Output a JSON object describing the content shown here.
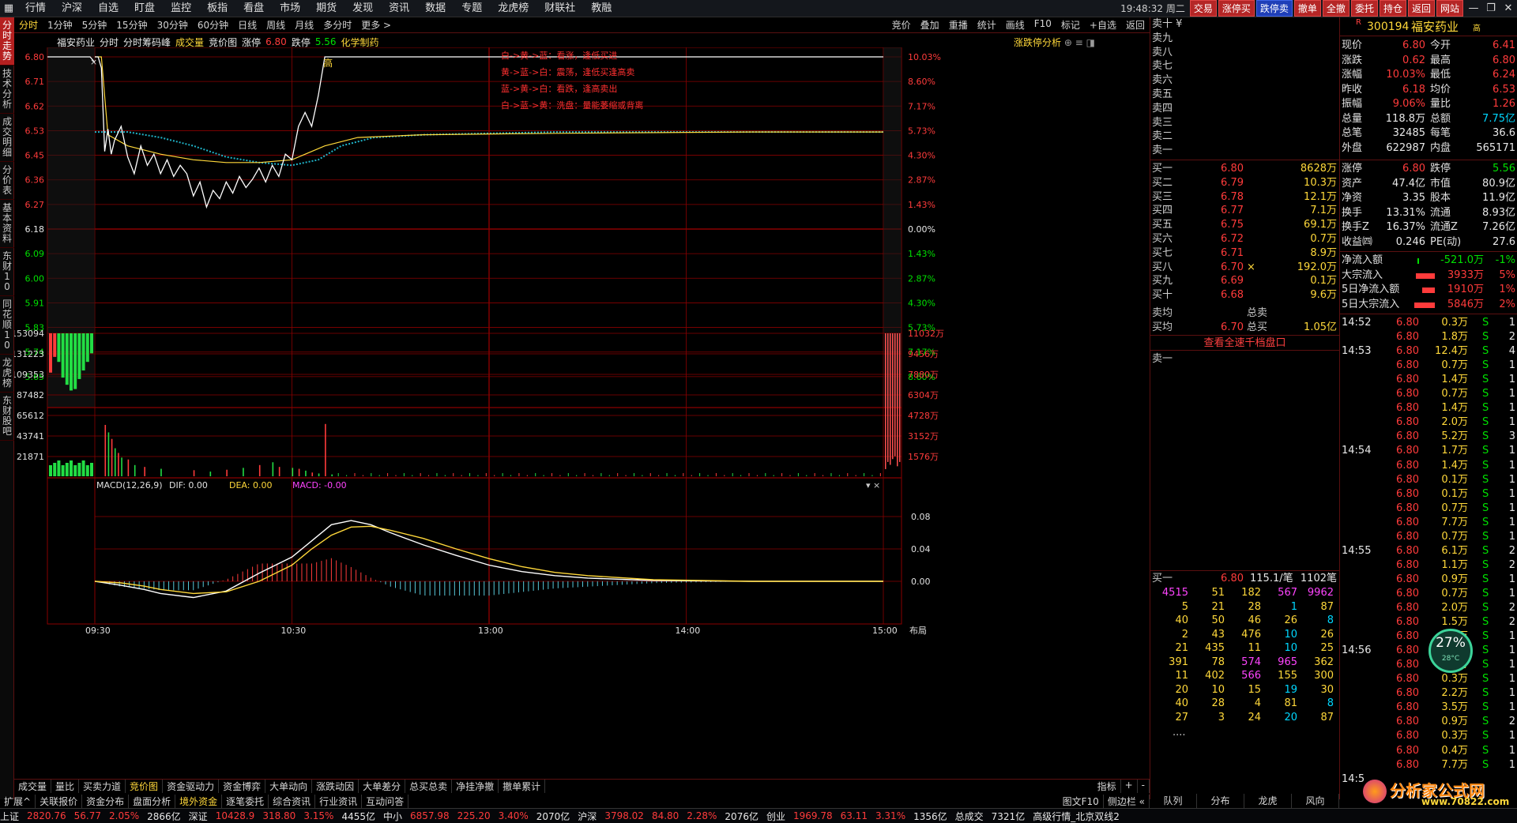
{
  "topbar": {
    "menu": [
      "行情",
      "沪深",
      "自选",
      "盯盘",
      "监控",
      "板指",
      "看盘",
      "市场",
      "期货",
      "发现",
      "资讯",
      "数据",
      "专题",
      "龙虎榜",
      "财联社",
      "教融"
    ],
    "clock": "19:48:32",
    "weekday": "周二",
    "buttons": [
      "交易",
      "涨停买",
      "跌停卖",
      "撤单",
      "全撤",
      "委托",
      "持仓",
      "返回",
      "网站"
    ]
  },
  "left_tabs": [
    "分时走势",
    "技术分析",
    "成交明细",
    "分价表",
    "基本资料",
    "东财10",
    "同花顺10",
    "龙虎榜",
    "东财股吧"
  ],
  "chart_toolbar": {
    "periods": [
      "分时",
      "1分钟",
      "5分钟",
      "15分钟",
      "30分钟",
      "60分钟",
      "日线",
      "周线",
      "月线",
      "多分时",
      "更多 >"
    ],
    "right": [
      "竞价",
      "叠加",
      "重播",
      "统计",
      "画线",
      "F10",
      "标记",
      "+自选",
      "返回"
    ]
  },
  "chart_info": {
    "name": "福安药业",
    "mode": "分时",
    "tags": [
      "分时筹码峰",
      "成交量",
      "竞价图"
    ],
    "limit_up_label": "涨停",
    "limit_up": "6.80",
    "limit_down_label": "跌停",
    "limit_down": "5.56",
    "sector": "化学制药",
    "analysis": "涨跌停分析"
  },
  "legend_notes": [
    "白->黄->蓝：看涨，逢低买进",
    "黄->蓝->白：震荡，逢低买逢高卖",
    "蓝->黄->白：看跌，逢高卖出",
    "白->蓝->黄：洗盘：量能萎缩或背离"
  ],
  "high_marker": "高",
  "chart_data": {
    "type": "line",
    "price_axis": {
      "left": [
        "6.80",
        "6.71",
        "6.62",
        "6.53",
        "6.45",
        "6.36",
        "6.27",
        "6.18",
        "6.09",
        "6.00",
        "5.91",
        "5.83",
        "5.74",
        "5.65"
      ],
      "right": [
        "10.03%",
        "8.60%",
        "7.17%",
        "5.73%",
        "4.30%",
        "2.87%",
        "1.43%",
        "0.00%",
        "1.43%",
        "2.87%",
        "4.30%",
        "5.73%",
        "7.17%",
        "8.60%"
      ],
      "ylim": [
        5.56,
        6.8
      ],
      "prev_close": 6.18
    },
    "volume_axis": {
      "left": [
        "153094",
        "131223",
        "109353",
        "87482",
        "65612",
        "43741",
        "21871"
      ],
      "right": [
        "11032万",
        "9456万",
        "7880万",
        "6304万",
        "4728万",
        "3152万",
        "1576万"
      ]
    },
    "macd": {
      "title": "MACD(12,26,9)",
      "dif_label": "DIF: 0.00",
      "dea_label": "DEA: 0.00",
      "macd_label": "MACD: -0.00",
      "ticks": [
        "0.08",
        "0.04",
        "0.00"
      ]
    },
    "time_axis": [
      "09:30",
      "10:30",
      "13:00",
      "14:00",
      "15:00"
    ],
    "time_axis_extra": "布局",
    "price_line": [
      [
        0,
        6.8
      ],
      [
        1,
        6.8
      ],
      [
        2,
        6.76
      ],
      [
        3,
        6.46
      ],
      [
        4,
        6.54
      ],
      [
        5,
        6.45
      ],
      [
        6,
        6.5
      ],
      [
        8,
        6.55
      ],
      [
        10,
        6.44
      ],
      [
        12,
        6.38
      ],
      [
        14,
        6.48
      ],
      [
        16,
        6.41
      ],
      [
        18,
        6.45
      ],
      [
        20,
        6.38
      ],
      [
        22,
        6.43
      ],
      [
        24,
        6.37
      ],
      [
        26,
        6.41
      ],
      [
        28,
        6.38
      ],
      [
        30,
        6.3
      ],
      [
        32,
        6.35
      ],
      [
        34,
        6.26
      ],
      [
        36,
        6.32
      ],
      [
        38,
        6.29
      ],
      [
        40,
        6.35
      ],
      [
        42,
        6.31
      ],
      [
        44,
        6.37
      ],
      [
        46,
        6.33
      ],
      [
        48,
        6.36
      ],
      [
        50,
        6.4
      ],
      [
        52,
        6.35
      ],
      [
        54,
        6.41
      ],
      [
        56,
        6.37
      ],
      [
        58,
        6.45
      ],
      [
        60,
        6.43
      ],
      [
        62,
        6.55
      ],
      [
        64,
        6.6
      ],
      [
        66,
        6.55
      ],
      [
        68,
        6.66
      ],
      [
        70,
        6.8
      ],
      [
        72,
        6.8
      ],
      [
        240,
        6.8
      ]
    ],
    "avg_line": [
      [
        0,
        6.8
      ],
      [
        2,
        6.8
      ],
      [
        4,
        6.52
      ],
      [
        10,
        6.48
      ],
      [
        20,
        6.45
      ],
      [
        30,
        6.43
      ],
      [
        40,
        6.42
      ],
      [
        50,
        6.42
      ],
      [
        60,
        6.43
      ],
      [
        70,
        6.48
      ],
      [
        80,
        6.51
      ],
      [
        100,
        6.52
      ],
      [
        140,
        6.525
      ],
      [
        200,
        6.53
      ],
      [
        240,
        6.53
      ]
    ],
    "cyan_line": [
      [
        0,
        6.53
      ],
      [
        5,
        6.53
      ],
      [
        10,
        6.53
      ],
      [
        15,
        6.52
      ],
      [
        20,
        6.51
      ],
      [
        30,
        6.48
      ],
      [
        40,
        6.44
      ],
      [
        50,
        6.42
      ],
      [
        60,
        6.41
      ],
      [
        68,
        6.43
      ],
      [
        75,
        6.48
      ],
      [
        85,
        6.51
      ],
      [
        100,
        6.52
      ],
      [
        140,
        6.53
      ],
      [
        240,
        6.53
      ]
    ],
    "volume_tall": [
      [
        3,
        55000
      ],
      [
        4,
        47000
      ],
      [
        5,
        40000
      ],
      [
        6,
        30000
      ],
      [
        7,
        25000
      ],
      [
        8,
        20000
      ],
      [
        10,
        18000
      ],
      [
        12,
        12000
      ],
      [
        15,
        10000
      ],
      [
        20,
        8000
      ],
      [
        30,
        6500
      ],
      [
        35,
        5000
      ],
      [
        40,
        7000
      ],
      [
        45,
        9000
      ],
      [
        50,
        12000
      ],
      [
        54,
        15000
      ],
      [
        56,
        10000
      ],
      [
        60,
        9000
      ],
      [
        62,
        8000
      ],
      [
        64,
        6000
      ],
      [
        66,
        4000
      ],
      [
        68,
        3000
      ],
      [
        70,
        56000
      ],
      [
        72,
        2000
      ]
    ],
    "opening_auction_bars": [
      0.55,
      0.33,
      0.4,
      0.62,
      0.72,
      0.8,
      0.78,
      0.64,
      0.52,
      0.4,
      0.28
    ],
    "closing_bars": [
      0.95,
      0.9,
      0.92,
      0.88,
      0.86,
      0.93,
      0.9
    ],
    "dif": [
      [
        0,
        0.0
      ],
      [
        8,
        -0.005
      ],
      [
        15,
        -0.01
      ],
      [
        20,
        -0.015
      ],
      [
        30,
        -0.02
      ],
      [
        40,
        -0.012
      ],
      [
        50,
        0.01
      ],
      [
        60,
        0.03
      ],
      [
        66,
        0.05
      ],
      [
        72,
        0.07
      ],
      [
        78,
        0.075
      ],
      [
        84,
        0.07
      ],
      [
        90,
        0.06
      ],
      [
        100,
        0.045
      ],
      [
        110,
        0.032
      ],
      [
        120,
        0.02
      ],
      [
        130,
        0.012
      ],
      [
        140,
        0.007
      ],
      [
        150,
        0.004
      ],
      [
        170,
        0.001
      ],
      [
        200,
        0.0
      ],
      [
        240,
        0.0
      ]
    ],
    "dea": [
      [
        0,
        0.0
      ],
      [
        8,
        -0.002
      ],
      [
        15,
        -0.006
      ],
      [
        20,
        -0.01
      ],
      [
        30,
        -0.015
      ],
      [
        40,
        -0.013
      ],
      [
        50,
        0.0
      ],
      [
        60,
        0.02
      ],
      [
        66,
        0.04
      ],
      [
        72,
        0.057
      ],
      [
        78,
        0.067
      ],
      [
        84,
        0.068
      ],
      [
        90,
        0.063
      ],
      [
        100,
        0.053
      ],
      [
        110,
        0.04
      ],
      [
        120,
        0.028
      ],
      [
        130,
        0.018
      ],
      [
        140,
        0.011
      ],
      [
        150,
        0.007
      ],
      [
        170,
        0.002
      ],
      [
        200,
        0.0
      ],
      [
        240,
        0.0
      ]
    ]
  },
  "order_book": {
    "sell_labels": [
      "卖十 ¥",
      "卖九",
      "卖八",
      "卖七",
      "卖六",
      "卖五",
      "卖四",
      "卖三",
      "卖二",
      "卖一"
    ],
    "buy": [
      {
        "label": "买一",
        "price": "6.80",
        "vol": "8628万"
      },
      {
        "label": "买二",
        "price": "6.79",
        "vol": "10.3万"
      },
      {
        "label": "买三",
        "price": "6.78",
        "vol": "12.1万"
      },
      {
        "label": "买四",
        "price": "6.77",
        "vol": "7.1万"
      },
      {
        "label": "买五",
        "price": "6.75",
        "vol": "69.1万"
      },
      {
        "label": "买六",
        "price": "6.72",
        "vol": "0.7万"
      },
      {
        "label": "买七",
        "price": "6.71",
        "vol": "8.9万"
      },
      {
        "label": "买八",
        "price": "6.70",
        "vol": "192.0万",
        "mark": "×"
      },
      {
        "label": "买九",
        "price": "6.69",
        "vol": "0.1万"
      },
      {
        "label": "买十",
        "price": "6.68",
        "vol": "9.6万"
      }
    ],
    "avg_sell_label": "卖均",
    "avg_buy_label": "买均",
    "avg_buy": "6.70",
    "total_sell_label": "总卖",
    "total_buy_label": "总买",
    "total_buy": "1.05亿",
    "view_all": "查看全速千档盘口",
    "sell1_label": "卖一",
    "queue_header": {
      "label": "买一",
      "price": "6.80",
      "per": "115.1/笔",
      "count": "1102笔"
    },
    "queue": [
      [
        "4515",
        "51",
        "182",
        "567",
        "9962"
      ],
      [
        "5",
        "21",
        "28",
        "1",
        "87"
      ],
      [
        "40",
        "50",
        "46",
        "26",
        "8"
      ],
      [
        "2",
        "43",
        "476",
        "10",
        "26"
      ],
      [
        "21",
        "435",
        "11",
        "10",
        "25"
      ],
      [
        "391",
        "78",
        "574",
        "965",
        "362"
      ],
      [
        "11",
        "402",
        "566",
        "155",
        "300"
      ],
      [
        "20",
        "10",
        "15",
        "19",
        "30"
      ],
      [
        "40",
        "28",
        "4",
        "81",
        "8"
      ],
      [
        "27",
        "3",
        "24",
        "20",
        "87"
      ]
    ],
    "queue_more": "....",
    "tabs": [
      "队列",
      "分布",
      "龙虎",
      "风向"
    ]
  },
  "quote": {
    "r_mark": "R",
    "code": "300194",
    "name": "福安药业",
    "suffix": "高",
    "stats": [
      [
        "现价",
        "6.80",
        "今开",
        "6.41"
      ],
      [
        "涨跌",
        "0.62",
        "最高",
        "6.80"
      ],
      [
        "涨幅",
        "10.03%",
        "最低",
        "6.24"
      ],
      [
        "昨收",
        "6.18",
        "均价",
        "6.53"
      ],
      [
        "振幅",
        "9.06%",
        "量比",
        "1.26"
      ],
      [
        "总量",
        "118.8万",
        "总额",
        "7.75亿"
      ],
      [
        "总笔",
        "32485",
        "每笔",
        "36.6"
      ],
      [
        "外盘",
        "622987",
        "内盘",
        "565171"
      ]
    ],
    "stats2": [
      [
        "涨停",
        "6.80",
        "跌停",
        "5.56"
      ],
      [
        "资产",
        "47.4亿",
        "市值",
        "80.9亿"
      ],
      [
        "净资",
        "3.35",
        "股本",
        "11.9亿"
      ],
      [
        "换手",
        "13.31%",
        "流通",
        "8.93亿"
      ],
      [
        "换手Z",
        "16.37%",
        "流通Z",
        "7.26亿"
      ],
      [
        "收益㈣",
        "0.246",
        "PE(动)",
        "27.6"
      ]
    ],
    "flows": [
      [
        "净流入额",
        "-521.0万",
        "-1%"
      ],
      [
        "大宗流入",
        "3933万",
        "5%"
      ],
      [
        "5日净流入额",
        "1910万",
        "1%"
      ],
      [
        "5日大宗流入",
        "5846万",
        "2%"
      ]
    ],
    "trades": [
      {
        "time": "14:52",
        "price": "6.80",
        "vol": "0.3万",
        "side": "S",
        "n": "1"
      },
      {
        "time": "",
        "price": "6.80",
        "vol": "1.8万",
        "side": "S",
        "n": "2"
      },
      {
        "time": "14:53",
        "price": "6.80",
        "vol": "12.4万",
        "side": "S",
        "n": "4"
      },
      {
        "time": "",
        "price": "6.80",
        "vol": "0.7万",
        "side": "S",
        "n": "1"
      },
      {
        "time": "",
        "price": "6.80",
        "vol": "1.4万",
        "side": "S",
        "n": "1"
      },
      {
        "time": "",
        "price": "6.80",
        "vol": "0.7万",
        "side": "S",
        "n": "1"
      },
      {
        "time": "",
        "price": "6.80",
        "vol": "1.4万",
        "side": "S",
        "n": "1"
      },
      {
        "time": "",
        "price": "6.80",
        "vol": "2.0万",
        "side": "S",
        "n": "1"
      },
      {
        "time": "",
        "price": "6.80",
        "vol": "5.2万",
        "side": "S",
        "n": "3"
      },
      {
        "time": "14:54",
        "price": "6.80",
        "vol": "1.7万",
        "side": "S",
        "n": "1"
      },
      {
        "time": "",
        "price": "6.80",
        "vol": "1.4万",
        "side": "S",
        "n": "1"
      },
      {
        "time": "",
        "price": "6.80",
        "vol": "0.1万",
        "side": "S",
        "n": "1"
      },
      {
        "time": "",
        "price": "6.80",
        "vol": "0.1万",
        "side": "S",
        "n": "1"
      },
      {
        "time": "",
        "price": "6.80",
        "vol": "0.7万",
        "side": "S",
        "n": "1"
      },
      {
        "time": "",
        "price": "6.80",
        "vol": "7.7万",
        "side": "S",
        "n": "1"
      },
      {
        "time": "",
        "price": "6.80",
        "vol": "0.7万",
        "side": "S",
        "n": "1"
      },
      {
        "time": "14:55",
        "price": "6.80",
        "vol": "6.1万",
        "side": "S",
        "n": "2"
      },
      {
        "time": "",
        "price": "6.80",
        "vol": "1.1万",
        "side": "S",
        "n": "2"
      },
      {
        "time": "",
        "price": "6.80",
        "vol": "0.9万",
        "side": "S",
        "n": "1"
      },
      {
        "time": "",
        "price": "6.80",
        "vol": "0.7万",
        "side": "S",
        "n": "1"
      },
      {
        "time": "",
        "price": "6.80",
        "vol": "2.0万",
        "side": "S",
        "n": "2"
      },
      {
        "time": "",
        "price": "6.80",
        "vol": "1.5万",
        "side": "S",
        "n": "2"
      },
      {
        "time": "",
        "price": "6.80",
        "vol": "0.7万",
        "side": "S",
        "n": "1"
      },
      {
        "time": "14:56",
        "price": "6.80",
        "vol": "0.7万",
        "side": "S",
        "n": "1"
      },
      {
        "time": "",
        "price": "6.80",
        "vol": "0.7万",
        "side": "S",
        "n": "1"
      },
      {
        "time": "",
        "price": "6.80",
        "vol": "0.3万",
        "side": "S",
        "n": "1"
      },
      {
        "time": "",
        "price": "6.80",
        "vol": "2.2万",
        "side": "S",
        "n": "1"
      },
      {
        "time": "",
        "price": "6.80",
        "vol": "3.5万",
        "side": "S",
        "n": "1"
      },
      {
        "time": "",
        "price": "6.80",
        "vol": "0.9万",
        "side": "S",
        "n": "2"
      },
      {
        "time": "",
        "price": "6.80",
        "vol": "0.3万",
        "side": "S",
        "n": "1"
      },
      {
        "time": "",
        "price": "6.80",
        "vol": "0.4万",
        "side": "S",
        "n": "1"
      },
      {
        "time": "",
        "price": "6.80",
        "vol": "7.7万",
        "side": "S",
        "n": "1"
      }
    ],
    "last_time": "14:5"
  },
  "bottom_tabs_1": [
    "成交量",
    "量比",
    "买卖力道",
    "竞价图",
    "资金驱动力",
    "资金博弈",
    "大单动向",
    "涨跌动因",
    "大单差分",
    "总买总卖",
    "净挂净撤",
    "撤单累计"
  ],
  "bottom_tabs_1_right": [
    "指标",
    "+",
    "-"
  ],
  "bottom_tabs_2": [
    "扩展^",
    "关联报价",
    "资金分布",
    "盘面分析",
    "境外资金",
    "逐笔委托",
    "综合资讯",
    "行业资讯",
    "互动问答"
  ],
  "bottom_tabs_2_right": [
    "图文F10",
    "侧边栏 «"
  ],
  "ticker": [
    {
      "name": "上证",
      "v1": "2820.76",
      "v2": "56.77",
      "v3": "2.05%",
      "amt": "2866亿"
    },
    {
      "name": "深证",
      "v1": "10428.9",
      "v2": "318.80",
      "v3": "3.15%",
      "amt": "4455亿"
    },
    {
      "name": "中小",
      "v1": "6857.98",
      "v2": "225.20",
      "v3": "3.40%",
      "amt": "2070亿"
    },
    {
      "name": "沪深",
      "v1": "3798.02",
      "v2": "84.80",
      "v3": "2.28%",
      "amt": "2076亿"
    },
    {
      "name": "创业",
      "v1": "1969.78",
      "v2": "63.11",
      "v3": "3.31%",
      "amt": "1356亿"
    }
  ],
  "ticker_total_label": "总成交",
  "ticker_total": "7321亿",
  "ticker_source": "高级行情_北京双线2",
  "widget": {
    "percent": "27%",
    "temp": "28°C"
  },
  "watermark": {
    "brand": "分析家公式网",
    "url": "www.70822.com"
  },
  "colors": {
    "up": "#ff3b3b",
    "down": "#00e000",
    "grid": "#8a0000",
    "avg": "#ffd83a",
    "price": "#ffffff",
    "cyan": "#1fb3c8"
  }
}
